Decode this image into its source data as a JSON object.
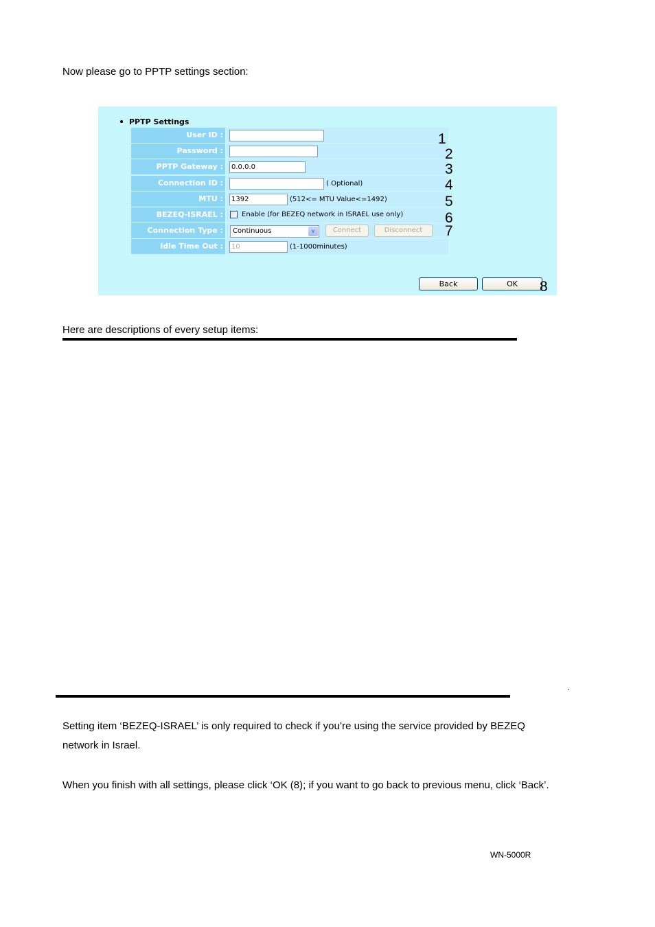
{
  "intro_text": "Now please go to PPTP settings section:",
  "pptp_panel": {
    "section_title": "PPTP Settings",
    "fields": {
      "user_id": {
        "label": "User ID :",
        "value": ""
      },
      "password": {
        "label": "Password :",
        "value": ""
      },
      "pptp_gateway": {
        "label": "PPTP Gateway :",
        "value": "0.0.0.0"
      },
      "connection_id": {
        "label": "Connection ID :",
        "value": "",
        "hint": "( Optional)"
      },
      "mtu": {
        "label": "MTU :",
        "value": "1392",
        "hint": "(512<= MTU Value<=1492)"
      },
      "bezeq_israel": {
        "label": "BEZEQ-ISRAEL :",
        "checked": false,
        "checkbox_label": "Enable (for BEZEQ network in ISRAEL use only)"
      },
      "connection_type": {
        "label": "Connection Type :",
        "selected": "Continuous",
        "connect_label": "Connect",
        "disconnect_label": "Disconnect"
      },
      "idle_time_out": {
        "label": "Idle Time Out :",
        "value": "10",
        "hint": "(1-1000minutes)"
      }
    },
    "back_label": "Back",
    "ok_label": "OK",
    "callouts": [
      "1",
      "2",
      "3",
      "4",
      "5",
      "6",
      "7",
      "8"
    ]
  },
  "descriptions_heading": "Here are descriptions of every setup items:",
  "trailing_dot": ".",
  "paragraphs": [
    "Setting item ‘BEZEQ-ISRAEL’ is only required to check if you’re using the service provided by BEZEQ",
    "network in Israel.",
    "When you finish with all settings, please click ‘OK (8); if you want to go back to previous menu, click ‘Back’."
  ],
  "footer_model": "WN-5000R"
}
